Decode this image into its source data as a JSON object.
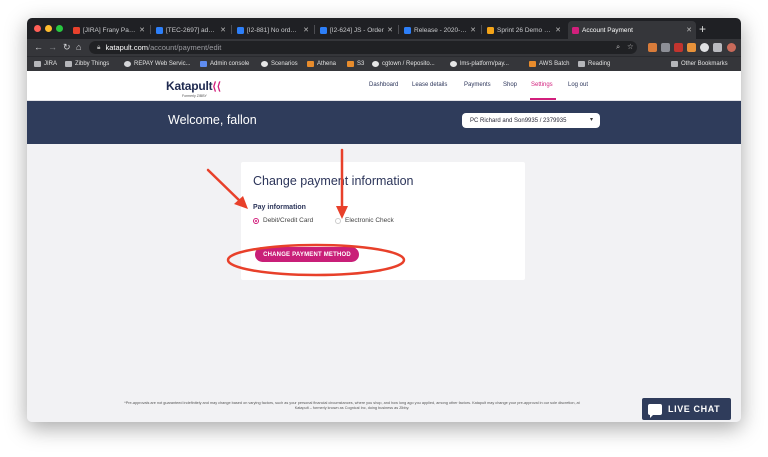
{
  "browser": {
    "tabs": [
      {
        "title": "[JIRA] Frany Patel m",
        "favicon_color": "#e8412c"
      },
      {
        "title": "[TEC-2697] add ne",
        "favicon_color": "#2d7ff9"
      },
      {
        "title": "[I2-881] No order n",
        "favicon_color": "#2d7ff9"
      },
      {
        "title": "[I2-624] JS - Order",
        "favicon_color": "#2d7ff9"
      },
      {
        "title": "Release - 2020-06-",
        "favicon_color": "#2d7ff9"
      },
      {
        "title": "Sprint 26 Demo - G",
        "favicon_color": "#f4a418"
      },
      {
        "title": "Account Payment",
        "favicon_color": "#d21f7c"
      }
    ],
    "address": {
      "domain": "katapult.com",
      "path": "/account/payment/edit"
    },
    "bookmarks": [
      {
        "label": "JIRA",
        "icon": "folder-icon"
      },
      {
        "label": "Zibby Things",
        "icon": "folder-icon"
      },
      {
        "label": "REPAY Web Servic...",
        "icon": "globe-icon"
      },
      {
        "label": "Admin console",
        "icon": "shield-icon"
      },
      {
        "label": "Scenarios",
        "icon": "github-icon"
      },
      {
        "label": "Athena",
        "icon": "aws-icon"
      },
      {
        "label": "S3",
        "icon": "aws-icon"
      },
      {
        "label": "cgtown / Reposito...",
        "icon": "github-icon"
      },
      {
        "label": "lms-platform/pay...",
        "icon": "github-icon"
      },
      {
        "label": "AWS Batch",
        "icon": "aws-icon"
      },
      {
        "label": "Reading",
        "icon": "folder-icon"
      }
    ],
    "other_bookmarks": "Other Bookmarks"
  },
  "site": {
    "logo": {
      "name": "Katapult",
      "sub": "Formerly ZIBBY"
    },
    "nav": [
      {
        "label": "Dashboard",
        "active": false
      },
      {
        "label": "Lease details",
        "active": false
      },
      {
        "label": "Payments",
        "active": false
      },
      {
        "label": "Shop",
        "active": false
      },
      {
        "label": "Settings",
        "active": true
      },
      {
        "label": "Log out",
        "active": false
      }
    ],
    "welcome": "Welcome, fallon",
    "account_selector": "PC Richard and Son9935 / 2379935",
    "accent": "#d21f7c",
    "header_bg": "#2f3c5b"
  },
  "card": {
    "title": "Change payment information",
    "section_label": "Pay information",
    "options": [
      {
        "label": "Debit/Credit Card",
        "selected": true
      },
      {
        "label": "Electronic Check",
        "selected": false
      }
    ],
    "button_label": "CHANGE PAYMENT METHOD"
  },
  "footer": {
    "disclaimer_line1": "*Pre-approvals are not guaranteed indefinitely and may change based on varying factors, such as your personal financial circumstances, where you shop, and how long ago you applied, among other factors. Katapult may change your pre-approval in our sole discretion, at",
    "disclaimer_line2": "Katapult – formerly known as Cognical Inc, doing business as Zibby."
  },
  "chat": {
    "label": "LIVE CHAT"
  },
  "annotation_color": "#e8402a"
}
